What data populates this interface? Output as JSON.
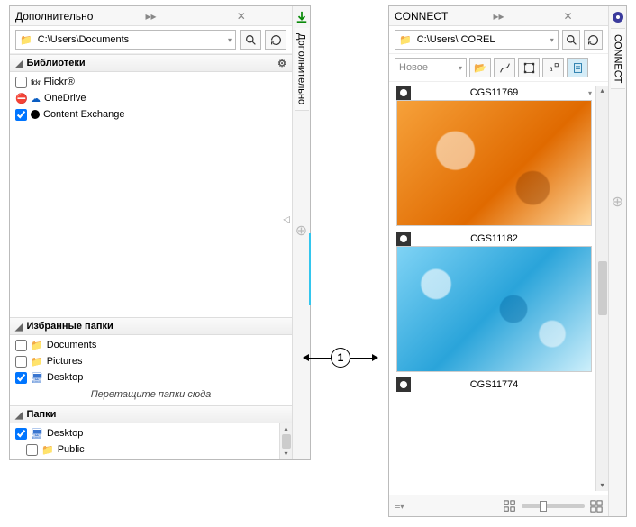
{
  "callout": {
    "number": "1"
  },
  "left_panel": {
    "title": "Дополнительно",
    "path": "C:\\Users\\Documents",
    "sidebar_tab": "Дополнительно",
    "libraries": {
      "header": "Библиотеки",
      "items": [
        {
          "label": "Flickr®",
          "checked": false,
          "icon": "flickr"
        },
        {
          "label": "OneDrive",
          "checked": false,
          "icon": "onedrive"
        },
        {
          "label": "Content Exchange",
          "checked": true,
          "icon": "content"
        }
      ]
    },
    "favorites": {
      "header": "Избранные папки",
      "items": [
        {
          "label": "Documents",
          "checked": false
        },
        {
          "label": "Pictures",
          "checked": false
        },
        {
          "label": "Desktop",
          "checked": true
        }
      ],
      "drop_hint": "Перетащите папки сюда"
    },
    "folders": {
      "header": "Папки",
      "items": [
        {
          "label": "Desktop",
          "checked": true
        },
        {
          "label": "Public",
          "checked": false
        }
      ]
    }
  },
  "right_panel": {
    "title": "CONNECT",
    "path": "C:\\Users\\ COREL",
    "sidebar_tab": "CONNECT",
    "filter_label": "Новое",
    "results": [
      {
        "name": "CGS11769",
        "thumb": "orange"
      },
      {
        "name": "CGS11182",
        "thumb": "blue"
      },
      {
        "name": "CGS11774",
        "thumb": "none"
      }
    ]
  }
}
